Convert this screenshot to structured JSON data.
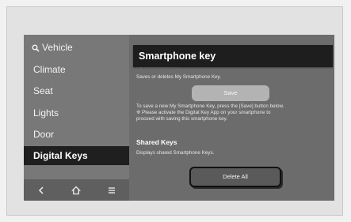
{
  "sidebar": {
    "search_label": "Vehicle",
    "items": [
      {
        "label": "Climate"
      },
      {
        "label": "Seat"
      },
      {
        "label": "Lights"
      },
      {
        "label": "Door"
      },
      {
        "label": "Digital Keys",
        "selected": true
      }
    ],
    "bottom_nav": [
      "back-icon",
      "home-icon",
      "menu-icon"
    ]
  },
  "content": {
    "title": "Smartphone key",
    "faded_heading": "My Smartphone Key",
    "manage_desc": "Saves or deletes My Smartphone Key.",
    "save_label": "Save",
    "save_note_1": "To save a new My Smartphone Key, press the [Save] button below.",
    "save_note_2": "※ Please activate the Digital Key App on your smartphone to",
    "save_note_3": "proceed with saving this smartphone key.",
    "shared_title": "Shared Keys",
    "shared_desc": "Displays shared Smartphone Keys.",
    "delete_label": "Delete All"
  },
  "colors": {
    "sidebar_bg": "#787878",
    "content_bg": "#6c6c6c",
    "selected_bg": "#1f1f1f",
    "header_bg": "#1e1e1e"
  }
}
